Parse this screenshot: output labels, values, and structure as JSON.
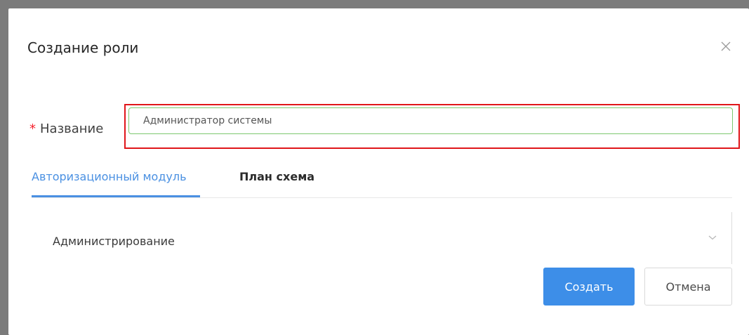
{
  "modal": {
    "title": "Создание роли",
    "close_icon": "close-icon"
  },
  "form": {
    "required_mark": "*",
    "name_label": "Название",
    "name_value": "Администратор системы"
  },
  "tabs": [
    {
      "label": "Авторизационный модуль",
      "active": true
    },
    {
      "label": "План схема",
      "active": false
    }
  ],
  "panel": {
    "label": "Администрирование",
    "chevron_icon": "chevron-down-icon"
  },
  "buttons": {
    "create_label": "Создать",
    "cancel_label": "Отмена"
  },
  "colors": {
    "accent": "#4a90e2",
    "primary_button": "#3d8ee8",
    "input_border": "#7cc86e",
    "highlight": "#e0161a",
    "required": "#f5222d"
  }
}
